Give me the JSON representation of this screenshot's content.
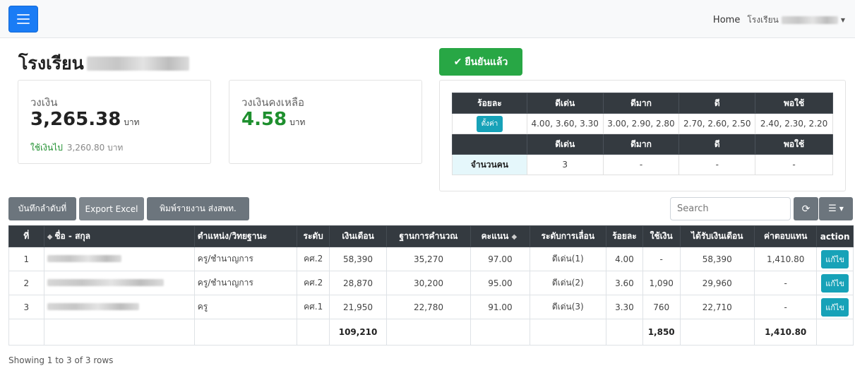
{
  "nav": {
    "home": "Home",
    "school_prefix": "โรงเรียน"
  },
  "page": {
    "title_prefix": "โรงเรียน"
  },
  "budget_card": {
    "label": "วงเงิน",
    "value": "3,265.38",
    "unit": "บาท",
    "spent_label": "ใช้เงินไป",
    "spent_value": "3,260.80 บาท"
  },
  "remaining_card": {
    "label": "วงเงินคงเหลือ",
    "value": "4.58",
    "unit": "บาท"
  },
  "confirm_button": {
    "icon": "✔",
    "label": "ยืนยันแล้ว"
  },
  "criteria": {
    "header1": [
      "ร้อยละ",
      "ดีเด่น",
      "ดีมาก",
      "ดี",
      "พอใช้"
    ],
    "set_button": "ตั้งค่า",
    "rates": [
      "4.00, 3.60, 3.30",
      "3.00, 2.90, 2.80",
      "2.70, 2.60, 2.50",
      "2.40, 2.30, 2.20"
    ],
    "header2": [
      "",
      "ดีเด่น",
      "ดีมาก",
      "ดี",
      "พอใช้"
    ],
    "count_label": "จำนวนคน",
    "counts": [
      "3",
      "-",
      "-",
      "-"
    ]
  },
  "toolbar": {
    "save_order": "บันทึกลำดับที่",
    "export_excel": "Export Excel",
    "print_report": "พิมพ์รายงาน ส่งสพท.",
    "search_placeholder": "Search",
    "refresh_icon": "refresh-icon",
    "columns_icon": "columns-icon"
  },
  "table": {
    "headers": [
      "ที่",
      "ชื่อ - สกุล",
      "ตำแหน่ง/วิทยฐานะ",
      "ระดับ",
      "เงินเดือน",
      "ฐานการคำนวณ",
      "คะแนน",
      "ระดับการเลื่อน",
      "ร้อยละ",
      "ใช้เงิน",
      "ได้รับเงินเดือน",
      "ค่าตอบแทน",
      "action"
    ],
    "rows": [
      {
        "no": "1",
        "position": "ครู/ชำนาญการ",
        "level": "คศ.2",
        "salary": "58,390",
        "base": "35,270",
        "score": "97.00",
        "promotion": "ดีเด่น(1)",
        "percent": "4.00",
        "used": "-",
        "new_salary": "58,390",
        "compensation": "1,410.80",
        "action": "แก้ไข"
      },
      {
        "no": "2",
        "position": "ครู/ชำนาญการ",
        "level": "คศ.2",
        "salary": "28,870",
        "base": "30,200",
        "score": "95.00",
        "promotion": "ดีเด่น(2)",
        "percent": "3.60",
        "used": "1,090",
        "new_salary": "29,960",
        "compensation": "-",
        "action": "แก้ไข"
      },
      {
        "no": "3",
        "position": "ครู",
        "level": "คศ.1",
        "salary": "21,950",
        "base": "22,780",
        "score": "91.00",
        "promotion": "ดีเด่น(3)",
        "percent": "3.30",
        "used": "760",
        "new_salary": "22,710",
        "compensation": "-",
        "action": "แก้ไข"
      }
    ],
    "totals": {
      "salary": "109,210",
      "used": "1,850",
      "compensation": "1,410.80"
    }
  },
  "footer": {
    "showing": "Showing 1 to 3 of 3 rows"
  }
}
